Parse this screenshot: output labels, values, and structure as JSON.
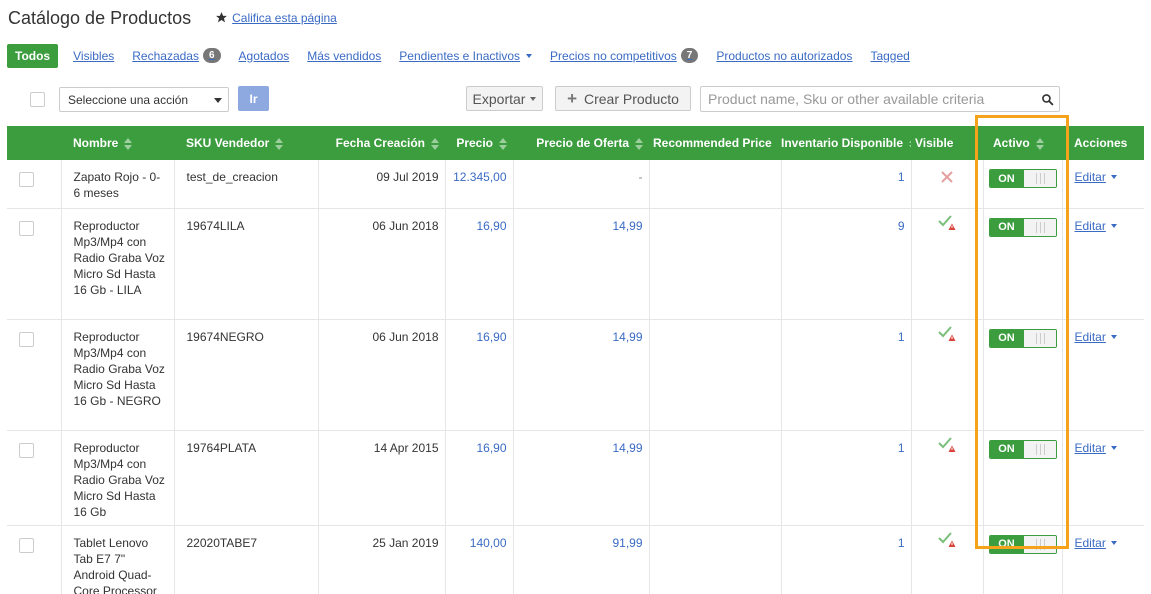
{
  "header": {
    "title": "Catálogo de Productos",
    "rate_label": "Califica esta página"
  },
  "tabs": [
    {
      "label": "Todos",
      "active": true
    },
    {
      "label": "Visibles"
    },
    {
      "label": "Rechazadas",
      "badge": "6"
    },
    {
      "label": "Agotados"
    },
    {
      "label": "Más vendidos"
    },
    {
      "label": "Pendientes e Inactivos",
      "dropdown": true
    },
    {
      "label": "Precios no competitivos",
      "badge": "7"
    },
    {
      "label": "Productos no autorizados"
    },
    {
      "label": "Tagged"
    }
  ],
  "toolbar": {
    "action_select": "Seleccione una acción",
    "go_label": "Ir",
    "export_label": "Exportar",
    "create_label": "Crear Producto",
    "search_placeholder": "Product name, Sku or other available criteria"
  },
  "table": {
    "columns": [
      "Nombre",
      "SKU Vendedor",
      "Fecha Creación",
      "Precio",
      "Precio de Oferta",
      "Recommended Price",
      "Inventario Disponible",
      "Visible",
      "Activo",
      "Acciones"
    ],
    "rows": [
      {
        "name": "Zapato Rojo - 0-6 meses",
        "sku": "test_de_creacion",
        "date": "09 Jul 2019",
        "price": "12.345,00",
        "offer": "-",
        "recommended": "",
        "stock": "1",
        "visible": "x",
        "active": "ON",
        "action": "Editar"
      },
      {
        "name": "Reproductor Mp3/Mp4 con Radio Graba Voz Micro Sd Hasta 16 Gb - LILA",
        "sku": "19674LILA",
        "date": "06 Jun 2018",
        "price": "16,90",
        "offer": "14,99",
        "recommended": "",
        "stock": "9",
        "visible": "check-warning",
        "active": "ON",
        "action": "Editar"
      },
      {
        "name": "Reproductor Mp3/Mp4 con Radio Graba Voz Micro Sd Hasta 16 Gb - NEGRO",
        "sku": "19674NEGRO",
        "date": "06 Jun 2018",
        "price": "16,90",
        "offer": "14,99",
        "recommended": "",
        "stock": "1",
        "visible": "check-warning",
        "active": "ON",
        "action": "Editar"
      },
      {
        "name": "Reproductor Mp3/Mp4 con Radio Graba Voz Micro Sd Hasta 16 Gb",
        "sku": "19764PLATA",
        "date": "14 Apr 2015",
        "price": "16,90",
        "offer": "14,99",
        "recommended": "",
        "stock": "1",
        "visible": "check-warning",
        "active": "ON",
        "action": "Editar"
      },
      {
        "name": "Tablet Lenovo Tab E7 7\" Android Quad-Core Processor",
        "sku": "22020TABE7",
        "date": "25 Jan 2019",
        "price": "140,00",
        "offer": "91,99",
        "recommended": "",
        "stock": "1",
        "visible": "check-warning",
        "active": "ON",
        "action": "Editar"
      }
    ]
  },
  "colors": {
    "accent": "#3c9d3e",
    "link": "#3a6bc4",
    "highlight": "#f5a31a"
  }
}
